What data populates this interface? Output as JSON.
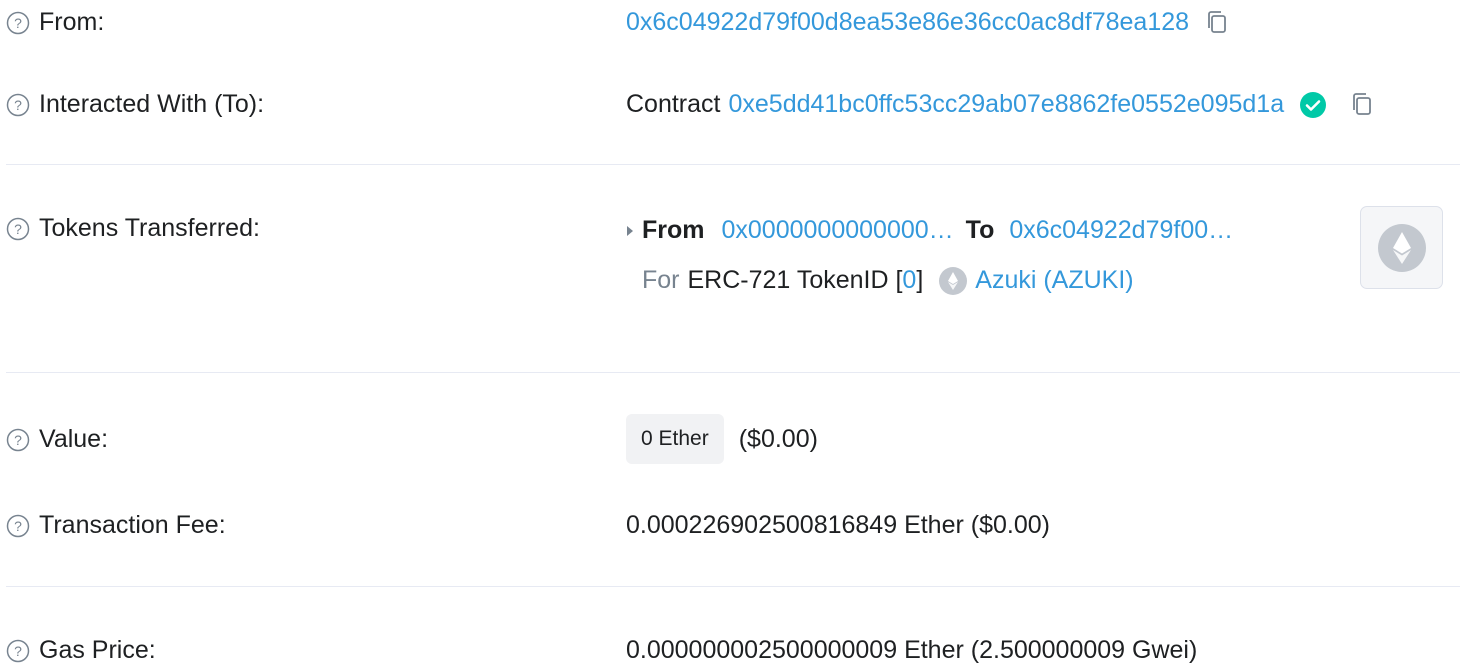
{
  "rows": {
    "from": {
      "label": "From:",
      "address": "0x6c04922d79f00d8ea53e86e36cc0ac8df78ea128"
    },
    "interacted": {
      "label": "Interacted With (To):",
      "prefix": "Contract",
      "address": "0xe5dd41bc0ffc53cc29ab07e8862fe0552e095d1a"
    },
    "tokens": {
      "label": "Tokens Transferred:",
      "from_label": "From",
      "from_address": "0x0000000000000…",
      "to_label": "To",
      "to_address": "0x6c04922d79f00…",
      "for_label": "For",
      "token_standard": "ERC-721 TokenID [",
      "token_id": "0",
      "bracket_close": "]",
      "token_name": "Azuki (AZUKI)"
    },
    "value": {
      "label": "Value:",
      "amount": "0 Ether",
      "usd": "($0.00)"
    },
    "fee": {
      "label": "Transaction Fee:",
      "amount": "0.000226902500816849 Ether ($0.00)"
    },
    "gas": {
      "label": "Gas Price:",
      "amount": "0.000000002500000009 Ether (2.500000009 Gwei)"
    }
  },
  "icons": {
    "help": "question-circle-icon",
    "copy": "copy-icon",
    "verified": "check-circle-icon",
    "token": "ethereum-icon",
    "expand": "caret-right-icon"
  },
  "colors": {
    "link": "#3498db",
    "text": "#1e2022",
    "muted": "#77838f",
    "divider": "#e7eaf3",
    "verified": "#00c9a7"
  }
}
